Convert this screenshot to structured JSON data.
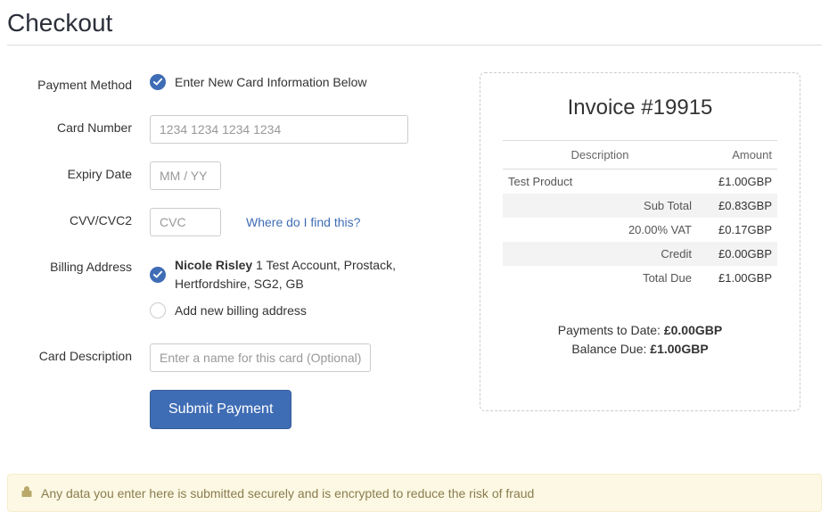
{
  "page_title": "Checkout",
  "form": {
    "payment_method_label": "Payment Method",
    "payment_method_option": "Enter New Card Information Below",
    "card_number_label": "Card Number",
    "card_number_placeholder": "1234 1234 1234 1234",
    "expiry_label": "Expiry Date",
    "expiry_placeholder": "MM / YY",
    "cvv_label": "CVV/CVC2",
    "cvv_placeholder": "CVC",
    "cvv_help_link": "Where do I find this?",
    "billing_label": "Billing Address",
    "billing_selected_name": "Nicole Risley",
    "billing_selected_rest": " 1 Test Account, Prostack, Hertfordshire, SG2, GB",
    "billing_add_new": "Add new billing address",
    "description_label": "Card Description",
    "description_placeholder": "Enter a name for this card (Optional)",
    "submit_label": "Submit Payment"
  },
  "invoice": {
    "title": "Invoice #19915",
    "col_desc": "Description",
    "col_amt": "Amount",
    "product_name": "Test Product",
    "product_amount": "£1.00GBP",
    "subtotal_label": "Sub Total",
    "subtotal_amount": "£0.83GBP",
    "vat_label": "20.00% VAT",
    "vat_amount": "£0.17GBP",
    "credit_label": "Credit",
    "credit_amount": "£0.00GBP",
    "totaldue_label": "Total Due",
    "totaldue_amount": "£1.00GBP",
    "payments_label": "Payments to Date: ",
    "payments_amount": "£0.00GBP",
    "balance_label": "Balance Due: ",
    "balance_amount": "£1.00GBP"
  },
  "notice": "Any data you enter here is submitted securely and is encrypted to reduce the risk of fraud"
}
